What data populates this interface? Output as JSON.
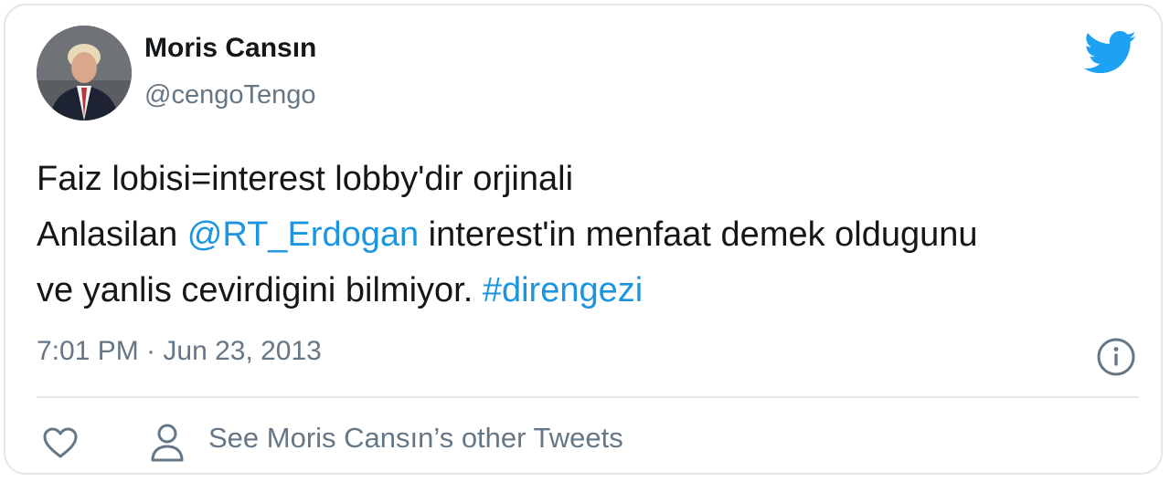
{
  "user": {
    "display_name": "Moris Cansın",
    "handle": "@cengoTengo"
  },
  "tweet": {
    "line1": "Faiz lobisi=interest lobby'dir orjinali",
    "line2_before": "Anlasilan ",
    "line2_mention": "@RT_Erdogan",
    "line2_after": " interest'in menfaat demek oldugunu",
    "line3_before": "ve yanlis cevirdigini bilmiyor. ",
    "line3_hashtag": "#direngezi"
  },
  "meta": {
    "timestamp": "7:01 PM · Jun 23, 2013"
  },
  "actions": {
    "other_tweets_label": "See Moris Cansın’s other Tweets"
  },
  "colors": {
    "link": "#1b95e0",
    "secondary_text": "#657786",
    "primary_text": "#14171a",
    "border": "#e1e8ed",
    "brand": "#1da1f2"
  },
  "icons": {
    "brand": "twitter-bird-icon",
    "info": "info-icon",
    "like": "heart-icon",
    "profile": "person-icon"
  }
}
